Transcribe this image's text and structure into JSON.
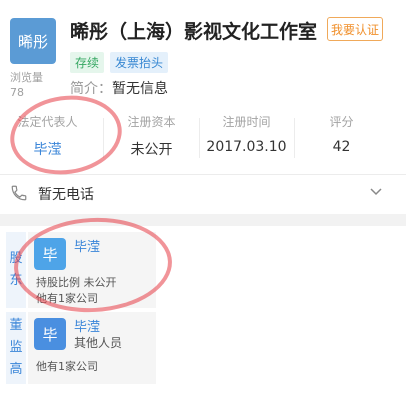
{
  "company": {
    "logo_text": "晞彤",
    "name": "晞彤（上海）影视文化工作室",
    "verify_button": "我要认证",
    "views_label": "浏览量",
    "views_count": "78",
    "tags": [
      "存续",
      "发票抬头"
    ],
    "intro_label": "简介：",
    "intro_value": "暂无信息"
  },
  "info": {
    "legal_rep_label": "法定代表人",
    "legal_rep_value": "毕滢",
    "capital_label": "注册资本",
    "capital_value": "未公开",
    "reg_time_label": "注册时间",
    "reg_time_value": "2017.03.10",
    "score_label": "评分",
    "score_value": "42"
  },
  "phone": {
    "text": "暂无电话"
  },
  "shareholders": {
    "side_label_1": "股",
    "side_label_2": "东",
    "person": {
      "avatar_text": "毕",
      "name": "毕滢",
      "line1": "持股比例 未公开",
      "line2": "他有1家公司"
    }
  },
  "directors": {
    "side_label_1": "董",
    "side_label_2": "监",
    "side_label_3": "高",
    "person": {
      "avatar_text": "毕",
      "name": "毕滢",
      "role": "其他人员",
      "line1": "他有1家公司"
    }
  },
  "colors": {
    "accent_blue": "#3a85d8",
    "verify_orange": "#f08f2a",
    "status_green": "#37a863",
    "annotation_red": "#e63c46"
  }
}
